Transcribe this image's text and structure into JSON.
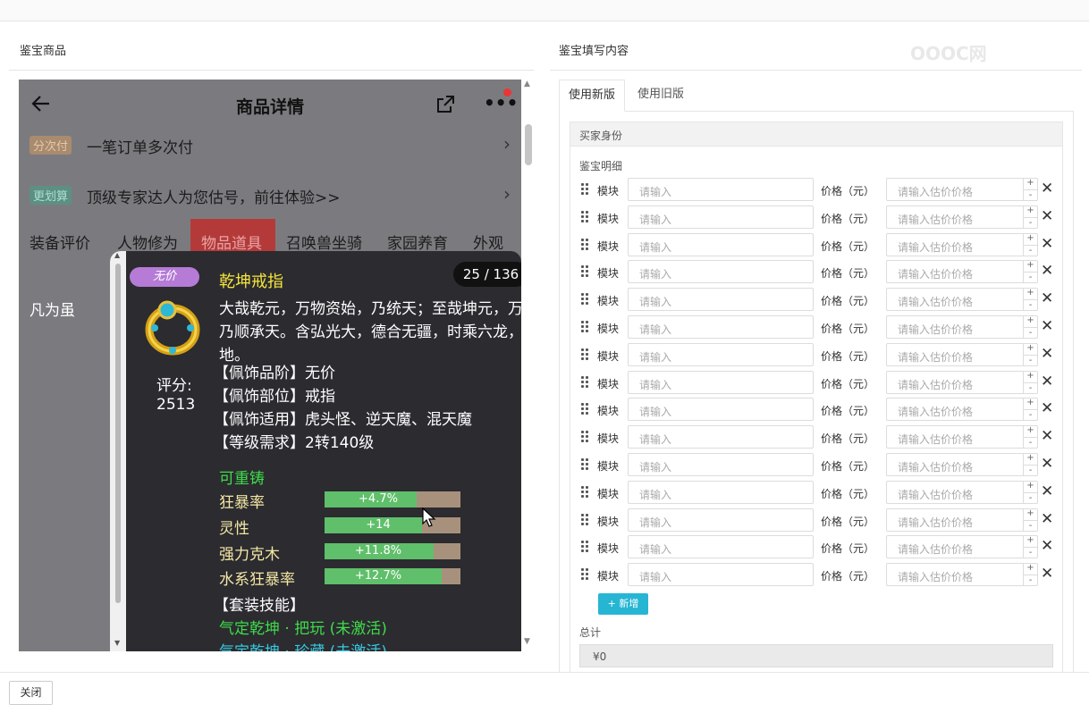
{
  "left_title": "鉴宝商品",
  "right_title": "鉴宝填写内容",
  "phone": {
    "title": "商品详情",
    "promos": [
      {
        "tag": "分次付",
        "text": "一笔订单多次付",
        "tag_bg": "#a98b6f",
        "tag_color": "#e6c8a8"
      },
      {
        "tag": "更划算",
        "text": "顶级专家达人为您估号，前往体验>>",
        "tag_bg": "#5d8f83",
        "tag_color": "#a8e0cf"
      }
    ],
    "tabs": [
      "装备评价",
      "人物修为",
      "物品道具",
      "召唤兽坐骑",
      "家园养育",
      "外观"
    ],
    "active_tab": "物品道具",
    "side_label": "凡为虽"
  },
  "item": {
    "badge": "无价",
    "name": "乾坤戒指",
    "counter": "25 / 136",
    "score_label": "评分:",
    "score": "2513",
    "desc_lines": [
      "大哉乾元，万物资始，乃统天；至哉坤元，万物",
      "乃顺承天。含弘光大，德合无疆，时乘六龙，以",
      "地。"
    ],
    "attrs": [
      "【佩饰品阶】无价",
      "【佩饰部位】戒指",
      "【佩饰适用】虎头怪、逆天魔、混天魔",
      "【等级需求】2转140级"
    ],
    "recast": "可重铸",
    "stats": [
      {
        "name": "狂暴率",
        "value": "+4.7%",
        "fill": 0.68
      },
      {
        "name": "灵性",
        "value": "+14",
        "fill": 0.72
      },
      {
        "name": "强力克木",
        "value": "+11.8%",
        "fill": 0.8
      },
      {
        "name": "水系狂暴率",
        "value": "+12.7%",
        "fill": 0.86
      }
    ],
    "suit_title": "【套装技能】",
    "suit_skills": [
      {
        "text": "气定乾坤 · 把玩 (未激活)",
        "color": "#3fdc4a"
      },
      {
        "text": "气定乾坤 · 珍藏 (未激活)",
        "color": "#36c9e0"
      }
    ]
  },
  "form": {
    "tabs": [
      "使用新版",
      "使用旧版"
    ],
    "active_tab": "使用新版",
    "buyer_header": "买家身份",
    "detail_label": "鉴宝明细",
    "module_label": "模块",
    "input_placeholder": "请输入",
    "price_label": "价格（元）",
    "price_placeholder": "请输入估价价格",
    "row_count": 15,
    "add_label": "+ 新增",
    "total_label": "总计",
    "total_value": "¥0"
  },
  "footer": {
    "close_label": "关闭"
  },
  "watermark": "OOOC网"
}
